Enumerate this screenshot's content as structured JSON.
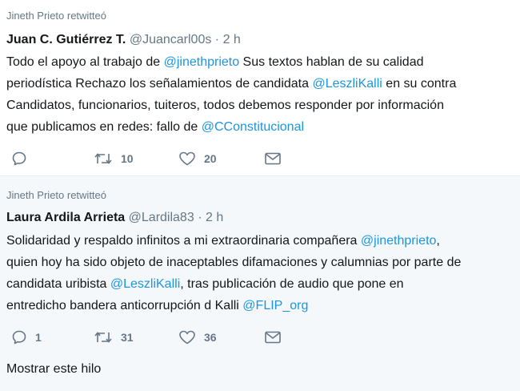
{
  "tweets": [
    {
      "retweet_line": "Jineth Prieto retwitteó",
      "author_name": "Juan C. Gutiérrez T.",
      "handle": "@Juancarl00s",
      "dot": "·",
      "time": "2 h",
      "lines": [
        [
          {
            "t": "Todo el apoyo al trabajo de "
          },
          {
            "t": "@jinethprieto",
            "m": true
          },
          {
            "t": " Sus textos hablan de su calidad"
          }
        ],
        [
          {
            "t": "periodística Rechazo los señalamientos de candidata "
          },
          {
            "t": "@LeszliKalli",
            "m": true
          },
          {
            "t": " en su contra"
          }
        ],
        [
          {
            "t": "Candidatos, funcionarios, tuiteros, todos debemos responder por información"
          }
        ],
        [
          {
            "t": "que publicamos en redes: fallo de "
          },
          {
            "t": "@CConstitucional",
            "m": true
          }
        ]
      ],
      "actions": {
        "reply_count": "",
        "retweet_count": "10",
        "like_count": "20"
      }
    },
    {
      "retweet_line": "Jineth Prieto retwitteó",
      "author_name": "Laura Ardila Arrieta",
      "handle": "@Lardila83",
      "dot": "·",
      "time": "2 h",
      "lines": [
        [
          {
            "t": "Solidaridad y respaldo infinitos a mi extraordinaria compañera  "
          },
          {
            "t": "@jinethprieto",
            "m": true
          },
          {
            "t": ","
          }
        ],
        [
          {
            "t": "quien hoy ha sido objeto de inaceptables difamaciones y calumnias por parte de"
          }
        ],
        [
          {
            "t": "candidata uribista "
          },
          {
            "t": "@LeszliKalli",
            "m": true
          },
          {
            "t": ", tras publicación de audio que pone en"
          }
        ],
        [
          {
            "t": "entredicho bandera anticorrupción d Kalli "
          },
          {
            "t": "@FLIP_org",
            "m": true
          }
        ]
      ],
      "actions": {
        "reply_count": "1",
        "retweet_count": "31",
        "like_count": "36"
      },
      "show_thread": "Mostrar este hilo"
    }
  ],
  "colors": {
    "mention": "#1b95e0",
    "secondary_text": "#657786",
    "icon": "#657786",
    "selected_background": "#f5f8fa"
  },
  "icons": {
    "reply": "reply-icon",
    "retweet": "retweet-icon",
    "like": "heart-icon",
    "message": "envelope-icon"
  }
}
